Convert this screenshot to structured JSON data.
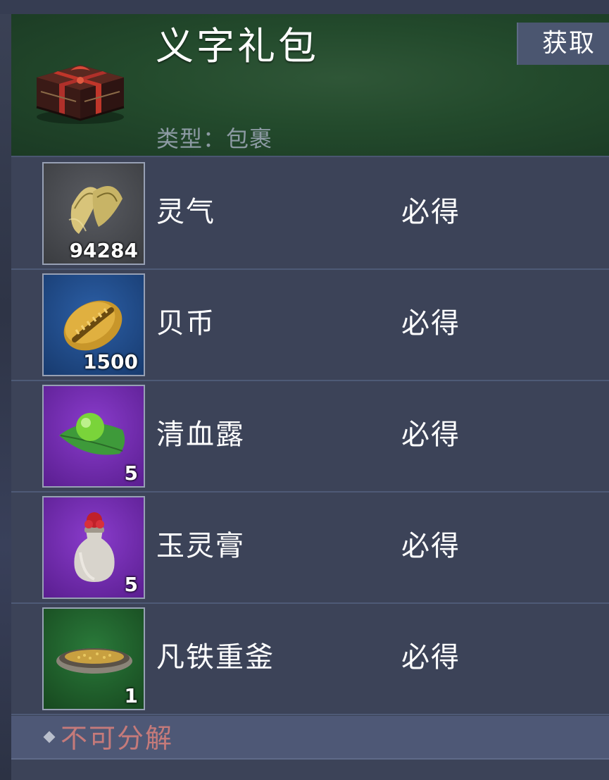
{
  "header": {
    "title": "义字礼包",
    "get_button": "获取",
    "type_line": "类型：包裹",
    "icon": "gift-box-icon"
  },
  "items": [
    {
      "name": "灵气",
      "quantity": "94284",
      "drop": "必得",
      "icon": "spirit-leaf-icon",
      "slot_color": "#4a4c50"
    },
    {
      "name": "贝币",
      "quantity": "1500",
      "drop": "必得",
      "icon": "cowrie-shell-icon",
      "slot_color": "#1f4b8c"
    },
    {
      "name": "清血露",
      "quantity": "5",
      "drop": "必得",
      "icon": "dew-leaf-icon",
      "slot_color": "#6a2aa0"
    },
    {
      "name": "玉灵膏",
      "quantity": "5",
      "drop": "必得",
      "icon": "jade-bottle-icon",
      "slot_color": "#6a2aa0"
    },
    {
      "name": "凡铁重釜",
      "quantity": "1",
      "drop": "必得",
      "icon": "iron-cauldron-icon",
      "slot_color": "#1e5a2c"
    }
  ],
  "footer": {
    "text": "不可分解"
  }
}
